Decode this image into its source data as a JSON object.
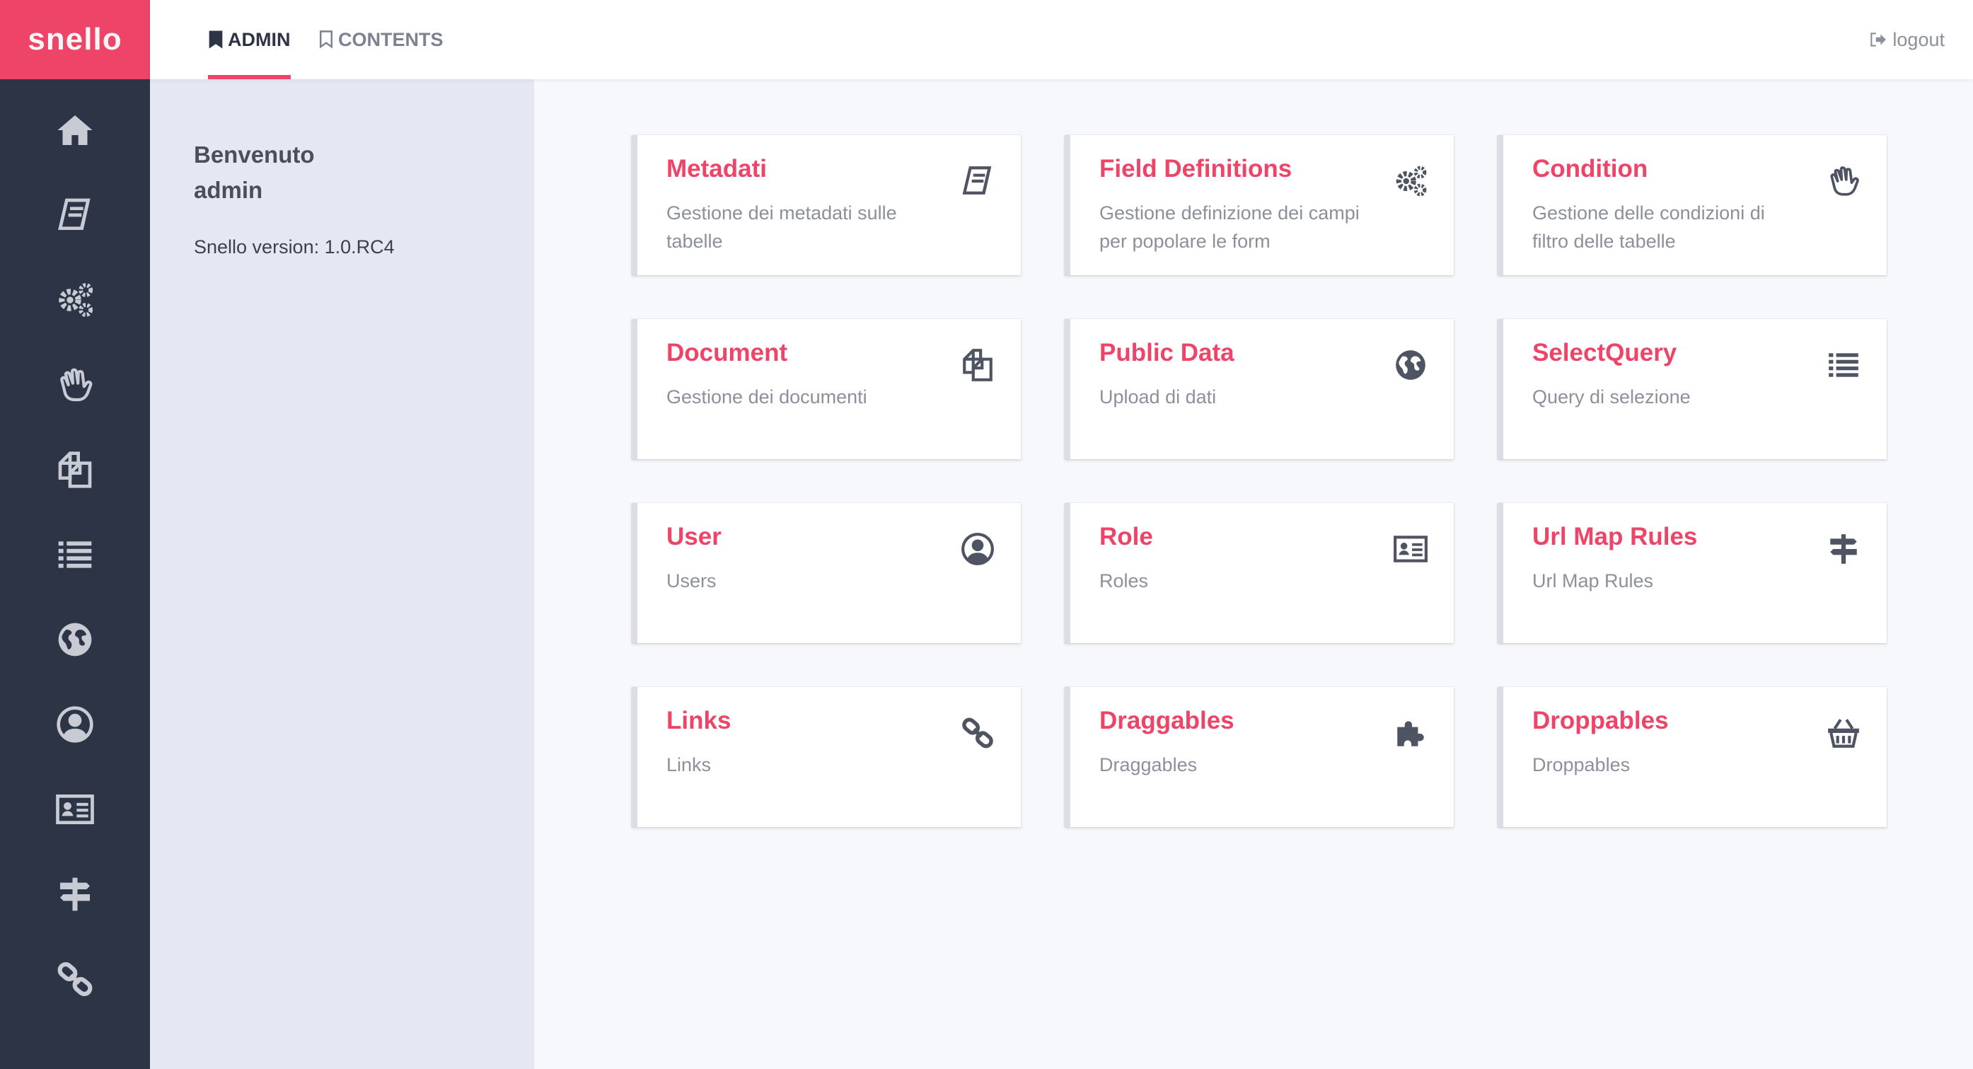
{
  "brand": {
    "logo_text": "snello",
    "accent": "#ee4468",
    "sidebar_bg": "#2d3446"
  },
  "topnav": {
    "tabs": [
      {
        "label": "ADMIN",
        "icon": "bookmark-filled-icon",
        "active": true
      },
      {
        "label": "CONTENTS",
        "icon": "bookmark-outline-icon",
        "active": false
      }
    ],
    "logout_label": "logout"
  },
  "sidebar": {
    "items": [
      {
        "icon": "home-icon"
      },
      {
        "icon": "book-icon"
      },
      {
        "icon": "gears-icon"
      },
      {
        "icon": "hand-icon"
      },
      {
        "icon": "copy-icon"
      },
      {
        "icon": "list-icon"
      },
      {
        "icon": "globe-icon"
      },
      {
        "icon": "user-circle-icon"
      },
      {
        "icon": "id-card-icon"
      },
      {
        "icon": "signpost-icon"
      },
      {
        "icon": "link-icon"
      }
    ]
  },
  "welcome": {
    "greeting": "Benvenuto",
    "username": "admin",
    "version": "Snello version: 1.0.RC4"
  },
  "cards": [
    {
      "title": "Metadati",
      "desc": "Gestione dei metadati sulle tabelle",
      "icon": "book-icon"
    },
    {
      "title": "Field Definitions",
      "desc": "Gestione definizione dei campi per popolare le form",
      "icon": "gears-icon"
    },
    {
      "title": "Condition",
      "desc": "Gestione delle condizioni di filtro delle tabelle",
      "icon": "hand-icon"
    },
    {
      "title": "Document",
      "desc": "Gestione dei documenti",
      "icon": "copy-icon"
    },
    {
      "title": "Public Data",
      "desc": "Upload di dati",
      "icon": "globe-icon"
    },
    {
      "title": "SelectQuery",
      "desc": "Query di selezione",
      "icon": "list-icon"
    },
    {
      "title": "User",
      "desc": "Users",
      "icon": "user-circle-icon"
    },
    {
      "title": "Role",
      "desc": "Roles",
      "icon": "id-card-icon"
    },
    {
      "title": "Url Map Rules",
      "desc": "Url Map Rules",
      "icon": "signpost-icon"
    },
    {
      "title": "Links",
      "desc": "Links",
      "icon": "link-icon"
    },
    {
      "title": "Draggables",
      "desc": "Draggables",
      "icon": "puzzle-icon"
    },
    {
      "title": "Droppables",
      "desc": "Droppables",
      "icon": "basket-icon"
    }
  ]
}
